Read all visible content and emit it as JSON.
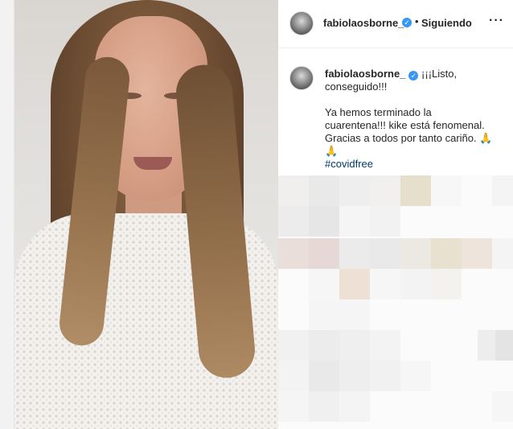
{
  "header": {
    "username": "fabiolaosborne_",
    "verified": "✓",
    "separator": "•",
    "follow_status": "Siguiendo",
    "more": "···"
  },
  "caption": {
    "username": "fabiolaosborne_",
    "verified": "✓",
    "line1": "¡¡¡Listo, conseguido!!!",
    "line2": "Ya hemos terminado la cuarentena!!! kike está fenomenal. Gracias a todos por tanto cariño. 🙏🙏",
    "hashtag": "#covidfree"
  },
  "colors": {
    "accent": "#3897f0",
    "hashtag": "#00376b",
    "text": "#262626"
  }
}
